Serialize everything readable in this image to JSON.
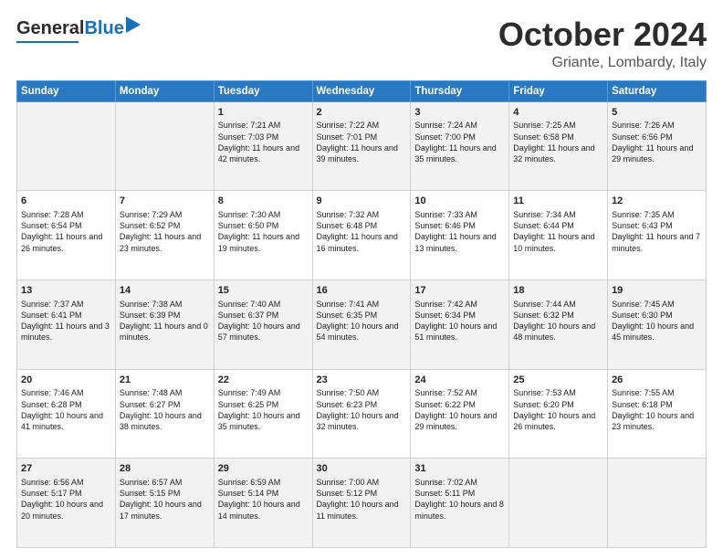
{
  "header": {
    "logo_general": "General",
    "logo_blue": "Blue",
    "month_title": "October 2024",
    "location": "Griante, Lombardy, Italy"
  },
  "days_of_week": [
    "Sunday",
    "Monday",
    "Tuesday",
    "Wednesday",
    "Thursday",
    "Friday",
    "Saturday"
  ],
  "weeks": [
    [
      {
        "day": "",
        "sunrise": "",
        "sunset": "",
        "daylight": ""
      },
      {
        "day": "",
        "sunrise": "",
        "sunset": "",
        "daylight": ""
      },
      {
        "day": "1",
        "sunrise": "Sunrise: 7:21 AM",
        "sunset": "Sunset: 7:03 PM",
        "daylight": "Daylight: 11 hours and 42 minutes."
      },
      {
        "day": "2",
        "sunrise": "Sunrise: 7:22 AM",
        "sunset": "Sunset: 7:01 PM",
        "daylight": "Daylight: 11 hours and 39 minutes."
      },
      {
        "day": "3",
        "sunrise": "Sunrise: 7:24 AM",
        "sunset": "Sunset: 7:00 PM",
        "daylight": "Daylight: 11 hours and 35 minutes."
      },
      {
        "day": "4",
        "sunrise": "Sunrise: 7:25 AM",
        "sunset": "Sunset: 6:58 PM",
        "daylight": "Daylight: 11 hours and 32 minutes."
      },
      {
        "day": "5",
        "sunrise": "Sunrise: 7:26 AM",
        "sunset": "Sunset: 6:56 PM",
        "daylight": "Daylight: 11 hours and 29 minutes."
      }
    ],
    [
      {
        "day": "6",
        "sunrise": "Sunrise: 7:28 AM",
        "sunset": "Sunset: 6:54 PM",
        "daylight": "Daylight: 11 hours and 26 minutes."
      },
      {
        "day": "7",
        "sunrise": "Sunrise: 7:29 AM",
        "sunset": "Sunset: 6:52 PM",
        "daylight": "Daylight: 11 hours and 23 minutes."
      },
      {
        "day": "8",
        "sunrise": "Sunrise: 7:30 AM",
        "sunset": "Sunset: 6:50 PM",
        "daylight": "Daylight: 11 hours and 19 minutes."
      },
      {
        "day": "9",
        "sunrise": "Sunrise: 7:32 AM",
        "sunset": "Sunset: 6:48 PM",
        "daylight": "Daylight: 11 hours and 16 minutes."
      },
      {
        "day": "10",
        "sunrise": "Sunrise: 7:33 AM",
        "sunset": "Sunset: 6:46 PM",
        "daylight": "Daylight: 11 hours and 13 minutes."
      },
      {
        "day": "11",
        "sunrise": "Sunrise: 7:34 AM",
        "sunset": "Sunset: 6:44 PM",
        "daylight": "Daylight: 11 hours and 10 minutes."
      },
      {
        "day": "12",
        "sunrise": "Sunrise: 7:35 AM",
        "sunset": "Sunset: 6:43 PM",
        "daylight": "Daylight: 11 hours and 7 minutes."
      }
    ],
    [
      {
        "day": "13",
        "sunrise": "Sunrise: 7:37 AM",
        "sunset": "Sunset: 6:41 PM",
        "daylight": "Daylight: 11 hours and 3 minutes."
      },
      {
        "day": "14",
        "sunrise": "Sunrise: 7:38 AM",
        "sunset": "Sunset: 6:39 PM",
        "daylight": "Daylight: 11 hours and 0 minutes."
      },
      {
        "day": "15",
        "sunrise": "Sunrise: 7:40 AM",
        "sunset": "Sunset: 6:37 PM",
        "daylight": "Daylight: 10 hours and 57 minutes."
      },
      {
        "day": "16",
        "sunrise": "Sunrise: 7:41 AM",
        "sunset": "Sunset: 6:35 PM",
        "daylight": "Daylight: 10 hours and 54 minutes."
      },
      {
        "day": "17",
        "sunrise": "Sunrise: 7:42 AM",
        "sunset": "Sunset: 6:34 PM",
        "daylight": "Daylight: 10 hours and 51 minutes."
      },
      {
        "day": "18",
        "sunrise": "Sunrise: 7:44 AM",
        "sunset": "Sunset: 6:32 PM",
        "daylight": "Daylight: 10 hours and 48 minutes."
      },
      {
        "day": "19",
        "sunrise": "Sunrise: 7:45 AM",
        "sunset": "Sunset: 6:30 PM",
        "daylight": "Daylight: 10 hours and 45 minutes."
      }
    ],
    [
      {
        "day": "20",
        "sunrise": "Sunrise: 7:46 AM",
        "sunset": "Sunset: 6:28 PM",
        "daylight": "Daylight: 10 hours and 41 minutes."
      },
      {
        "day": "21",
        "sunrise": "Sunrise: 7:48 AM",
        "sunset": "Sunset: 6:27 PM",
        "daylight": "Daylight: 10 hours and 38 minutes."
      },
      {
        "day": "22",
        "sunrise": "Sunrise: 7:49 AM",
        "sunset": "Sunset: 6:25 PM",
        "daylight": "Daylight: 10 hours and 35 minutes."
      },
      {
        "day": "23",
        "sunrise": "Sunrise: 7:50 AM",
        "sunset": "Sunset: 6:23 PM",
        "daylight": "Daylight: 10 hours and 32 minutes."
      },
      {
        "day": "24",
        "sunrise": "Sunrise: 7:52 AM",
        "sunset": "Sunset: 6:22 PM",
        "daylight": "Daylight: 10 hours and 29 minutes."
      },
      {
        "day": "25",
        "sunrise": "Sunrise: 7:53 AM",
        "sunset": "Sunset: 6:20 PM",
        "daylight": "Daylight: 10 hours and 26 minutes."
      },
      {
        "day": "26",
        "sunrise": "Sunrise: 7:55 AM",
        "sunset": "Sunset: 6:18 PM",
        "daylight": "Daylight: 10 hours and 23 minutes."
      }
    ],
    [
      {
        "day": "27",
        "sunrise": "Sunrise: 6:56 AM",
        "sunset": "Sunset: 5:17 PM",
        "daylight": "Daylight: 10 hours and 20 minutes."
      },
      {
        "day": "28",
        "sunrise": "Sunrise: 6:57 AM",
        "sunset": "Sunset: 5:15 PM",
        "daylight": "Daylight: 10 hours and 17 minutes."
      },
      {
        "day": "29",
        "sunrise": "Sunrise: 6:59 AM",
        "sunset": "Sunset: 5:14 PM",
        "daylight": "Daylight: 10 hours and 14 minutes."
      },
      {
        "day": "30",
        "sunrise": "Sunrise: 7:00 AM",
        "sunset": "Sunset: 5:12 PM",
        "daylight": "Daylight: 10 hours and 11 minutes."
      },
      {
        "day": "31",
        "sunrise": "Sunrise: 7:02 AM",
        "sunset": "Sunset: 5:11 PM",
        "daylight": "Daylight: 10 hours and 8 minutes."
      },
      {
        "day": "",
        "sunrise": "",
        "sunset": "",
        "daylight": ""
      },
      {
        "day": "",
        "sunrise": "",
        "sunset": "",
        "daylight": ""
      }
    ]
  ]
}
